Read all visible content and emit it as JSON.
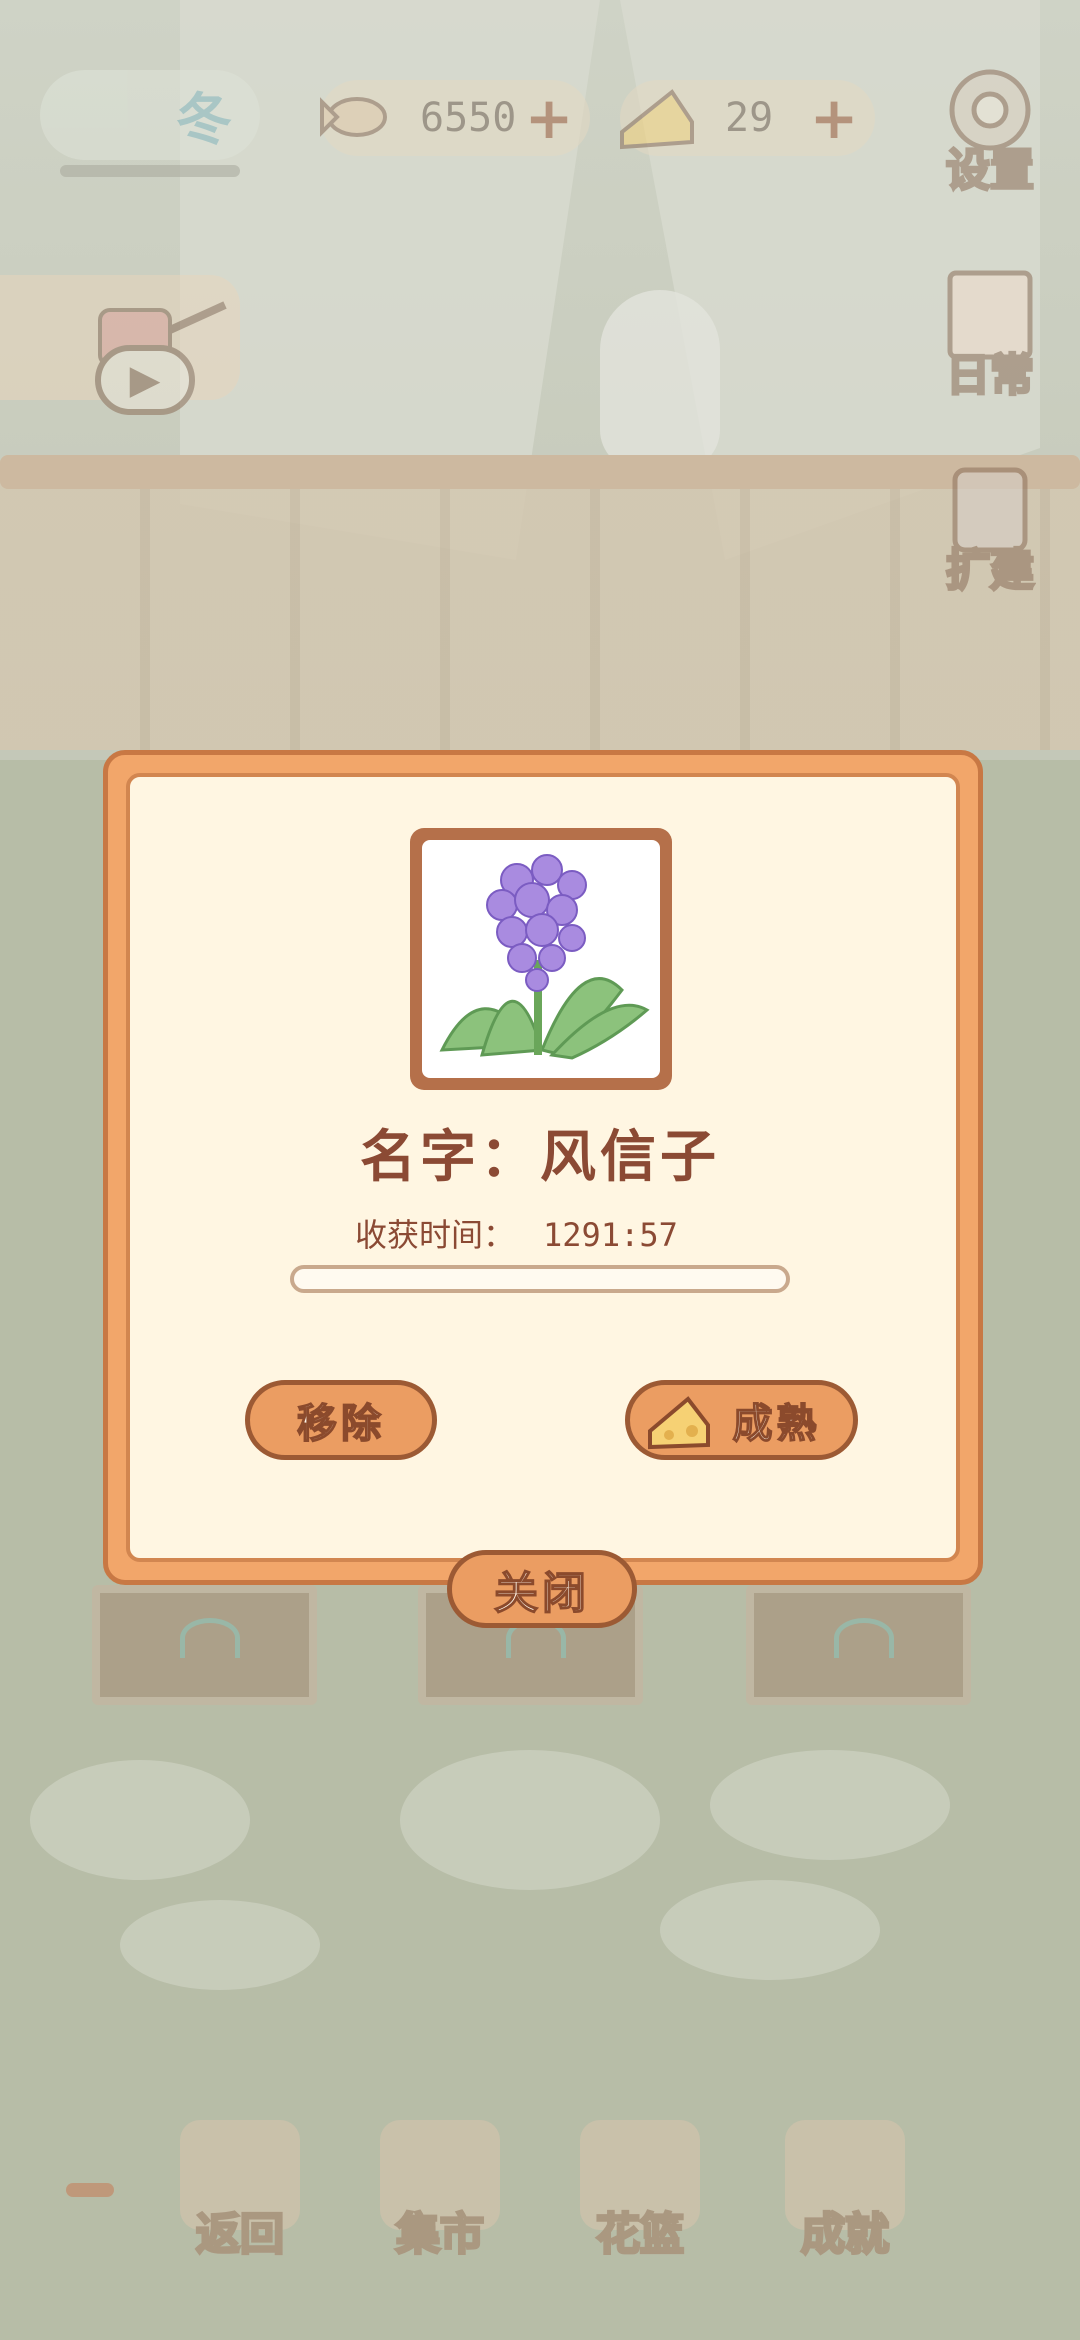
{
  "hud": {
    "season_label": "冬",
    "fish_amount": "6550",
    "cheese_amount": "29",
    "settings_label": "设置",
    "daily_label": "日常",
    "expand_label": "扩建"
  },
  "dialog": {
    "name_line": "名字：风信子",
    "harvest_time_label": "收获时间：",
    "harvest_time_value": "1291:57",
    "progress_fraction": 0.0,
    "remove_label": "移除",
    "mature_label": "成熟",
    "close_label": "关闭"
  },
  "bottom_nav": {
    "items": [
      {
        "label": "返回",
        "icon": "door-icon"
      },
      {
        "label": "集市",
        "icon": "market-stall-icon"
      },
      {
        "label": "花篮",
        "icon": "flower-basket-icon"
      },
      {
        "label": "成就",
        "icon": "trophy-icon"
      }
    ]
  },
  "colors": {
    "modal_border": "#f2a66a",
    "modal_background": "#fff6e2",
    "button_fill": "#eb9d62",
    "title_text": "#8b4a34",
    "flower_purple": "#a98be0",
    "leaf_green": "#8cc27c"
  }
}
